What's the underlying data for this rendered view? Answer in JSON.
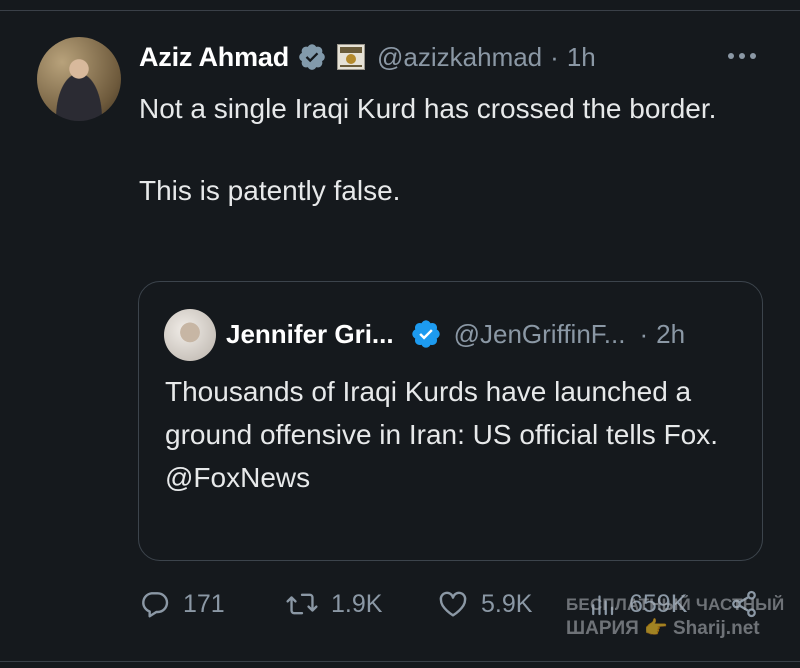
{
  "tweet": {
    "author_name": "Aziz Ahmad",
    "handle": "@azizkahmad",
    "separator": "·",
    "time": "1h",
    "text_line1": "Not a single Iraqi Kurd has crossed the border.",
    "text_line2": "This is patently false."
  },
  "quoted": {
    "author_name": "Jennifer Gri...",
    "handle": "@JenGriffinF...",
    "separator": "·",
    "time": "2h",
    "text_line1": "Thousands of Iraqi Kurds have launched a ground offensive in Iran: US official tells Fox.",
    "text_line2": "@FoxNews"
  },
  "actions": {
    "replies": "171",
    "retweets": "1.9K",
    "likes": "5.9K",
    "views": "659K"
  },
  "watermark": {
    "line1": "БЕСПЛАТНЫЙ ЧАСТНЫЙ",
    "line2": "ШАРИЯ 👉 Sharij.net"
  },
  "icons": {
    "verified_gray": "verified-badge-gray-icon",
    "verified_blue": "verified-badge-blue-icon",
    "flag": "kurdistan-flag-icon",
    "more": "more-options-icon",
    "reply": "reply-icon",
    "retweet": "retweet-icon",
    "like": "heart-icon",
    "views": "views-chart-icon",
    "share": "share-icon"
  },
  "colors": {
    "background": "#15191d",
    "text": "#e7e9ea",
    "muted": "#8b98a5",
    "verified_blue": "#1d9bf0",
    "verified_gray": "#829aab"
  }
}
